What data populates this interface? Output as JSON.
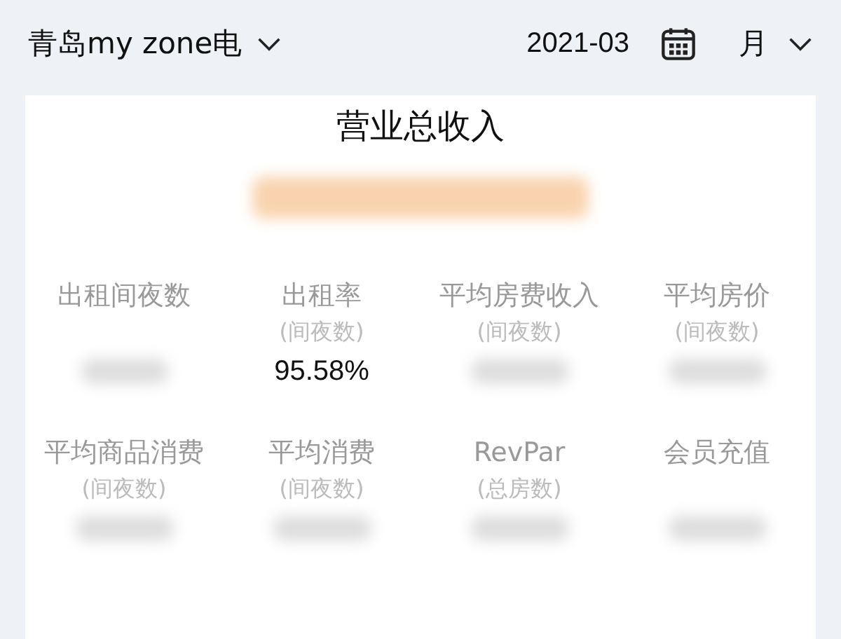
{
  "header": {
    "store": "青岛my zone电",
    "date": "2021-03",
    "period": "月"
  },
  "total": {
    "title": "营业总收入",
    "redacted": true
  },
  "metrics": [
    {
      "label": "出租间夜数",
      "redacted": true
    },
    {
      "label": "出租率",
      "sub": "(间夜数)",
      "value": "95.58%",
      "redacted": false
    },
    {
      "label": "平均房费收入",
      "sub": "(间夜数)",
      "redacted": true
    },
    {
      "label": "平均房价",
      "sub": "(间夜数)",
      "redacted": true
    },
    {
      "label": "平均商品消费",
      "sub": "(间夜数)",
      "redacted": true
    },
    {
      "label": "平均消费",
      "sub": "(间夜数)",
      "redacted": true
    },
    {
      "label": "RevPar",
      "sub": "(总房数)",
      "redacted": true
    },
    {
      "label": "会员充值",
      "redacted": true
    }
  ]
}
